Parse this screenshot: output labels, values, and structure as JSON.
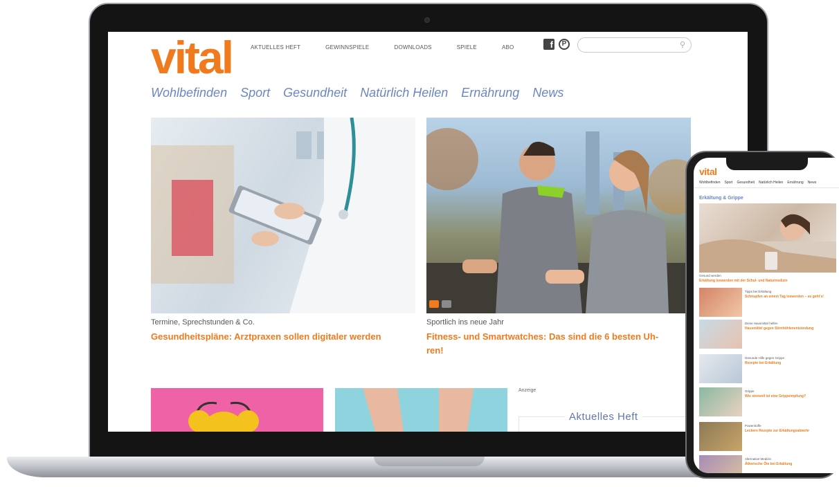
{
  "site": {
    "logo": "vital",
    "top_nav": [
      "AKTUELLES HEFT",
      "GEWINNSPIELE",
      "DOWNLOADS",
      "SPIELE",
      "ABO"
    ],
    "search_placeholder": "",
    "categories": [
      "Wohlbefinden",
      "Sport",
      "Gesundheit",
      "Natürlich Heilen",
      "Ernährung",
      "News"
    ]
  },
  "articles": [
    {
      "kicker": "Termine, Sprechstunden & Co.",
      "headline": "Gesundheitspläne: Arztpraxen sollen digitaler werden"
    },
    {
      "kicker": "Sportlich ins neue Jahr",
      "headline_line1": "Fitness- und Smartwatches: Das sind die 6 besten Uh-",
      "headline_line2": "ren!"
    }
  ],
  "sidebar": {
    "ad_label": "Anzeige",
    "heft_title": "Aktuelles Heft"
  },
  "phone": {
    "logo": "vital",
    "nav": [
      "Wohlbefinden",
      "Sport",
      "Gesundheit",
      "Natürlich Heilen",
      "Ernährung",
      "News"
    ],
    "section_title": "Erkältung & Grippe",
    "hero": {
      "kicker": "Gesund werden",
      "headline": "Erkältung loswerden mit der Schul- und Naturmedizin"
    },
    "items": [
      {
        "kicker": "Tipps bei Erkältung",
        "headline": "Schnupfen an einem Tag loswerden – so geht's!"
      },
      {
        "kicker": "Diese Hausmittel helfen",
        "headline": "Hausmittel gegen Stirnhöhlenentzündung"
      },
      {
        "kicker": "Gesunde Hilfe gegen Grippe",
        "headline": "Rezepte bei Erkältung"
      },
      {
        "kicker": "Grippe",
        "headline": "Wie sinnvoll ist eine Grippeimpfung?"
      },
      {
        "kicker": "Powerstoffe",
        "headline": "Leckere Rezepte zur Erkältungsabwehr"
      },
      {
        "kicker": "Alternative Medizin",
        "headline": "Ätherische Öle bei Erkältung"
      }
    ]
  },
  "colors": {
    "brand": "#f07a1e",
    "nav_blue": "#6b86c2"
  }
}
